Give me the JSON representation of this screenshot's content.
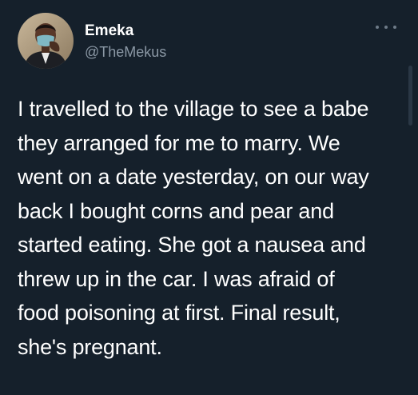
{
  "tweet": {
    "author": {
      "display_name": "Emeka",
      "handle": "@TheMekus",
      "avatar_icon": "profile-photo-masked-man"
    },
    "more_icon": "more-options-icon",
    "text_lines": [
      "I travelled to the village to see a babe",
      "they arranged for me to marry. We",
      "went on a date yesterday, on our way",
      "back I bought corns and pear and",
      "started eating. She got a nausea and",
      "threw up in the car. I was afraid of",
      "food poisoning at first. Final result,",
      "she's pregnant."
    ]
  },
  "colors": {
    "background": "#15202b",
    "text": "#ffffff",
    "secondary_text": "#8b98a5"
  }
}
